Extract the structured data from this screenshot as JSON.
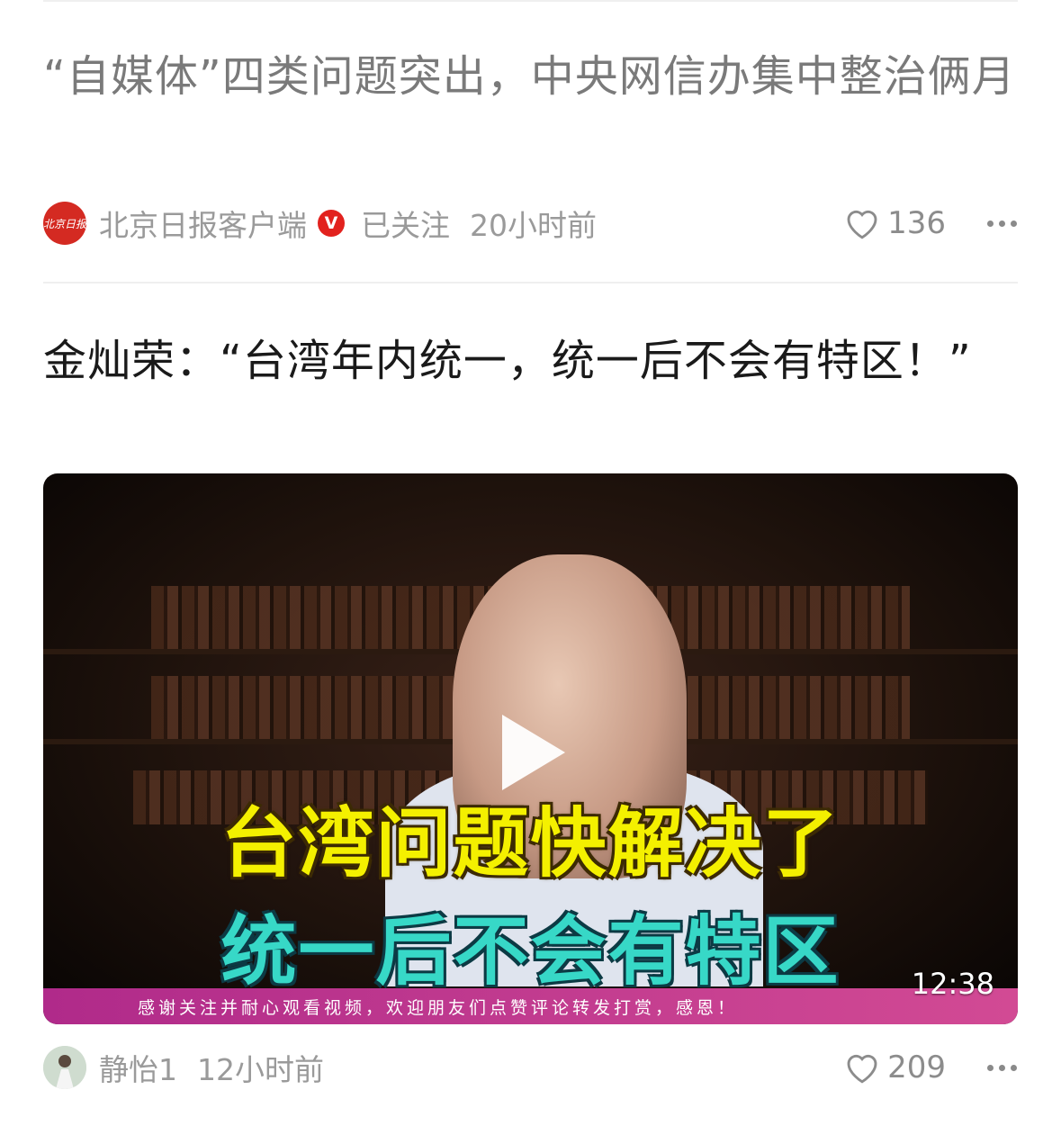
{
  "feed": {
    "item1": {
      "title": "“自媒体”四类问题突出，中央网信办集中整治俩月",
      "source": "北京日报客户端",
      "source_avatar_text": "北京日报",
      "verified_badge": "V",
      "follow_status": "已关注",
      "time": "20小时前",
      "likes": "136"
    },
    "item2": {
      "title": "金灿荣：“台湾年内统一，统一后不会有特区！”",
      "video": {
        "caption_line1": "台湾问题快解决了",
        "caption_line2": "统一后不会有特区",
        "ticker": "感谢关注并耐心观看视频，欢迎朋友们点赞评论转发打赏，感恩！",
        "duration": "12:38"
      },
      "author": "静怡1",
      "time": "12小时前",
      "likes": "209"
    }
  },
  "colors": {
    "badge_red": "#e2221e",
    "ticker_magenta": "#c13b8f",
    "caption_yellow": "#f4f000",
    "caption_teal": "#37d8c7"
  },
  "icons": [
    "heart-icon",
    "more-icon",
    "play-icon",
    "verified-icon"
  ]
}
